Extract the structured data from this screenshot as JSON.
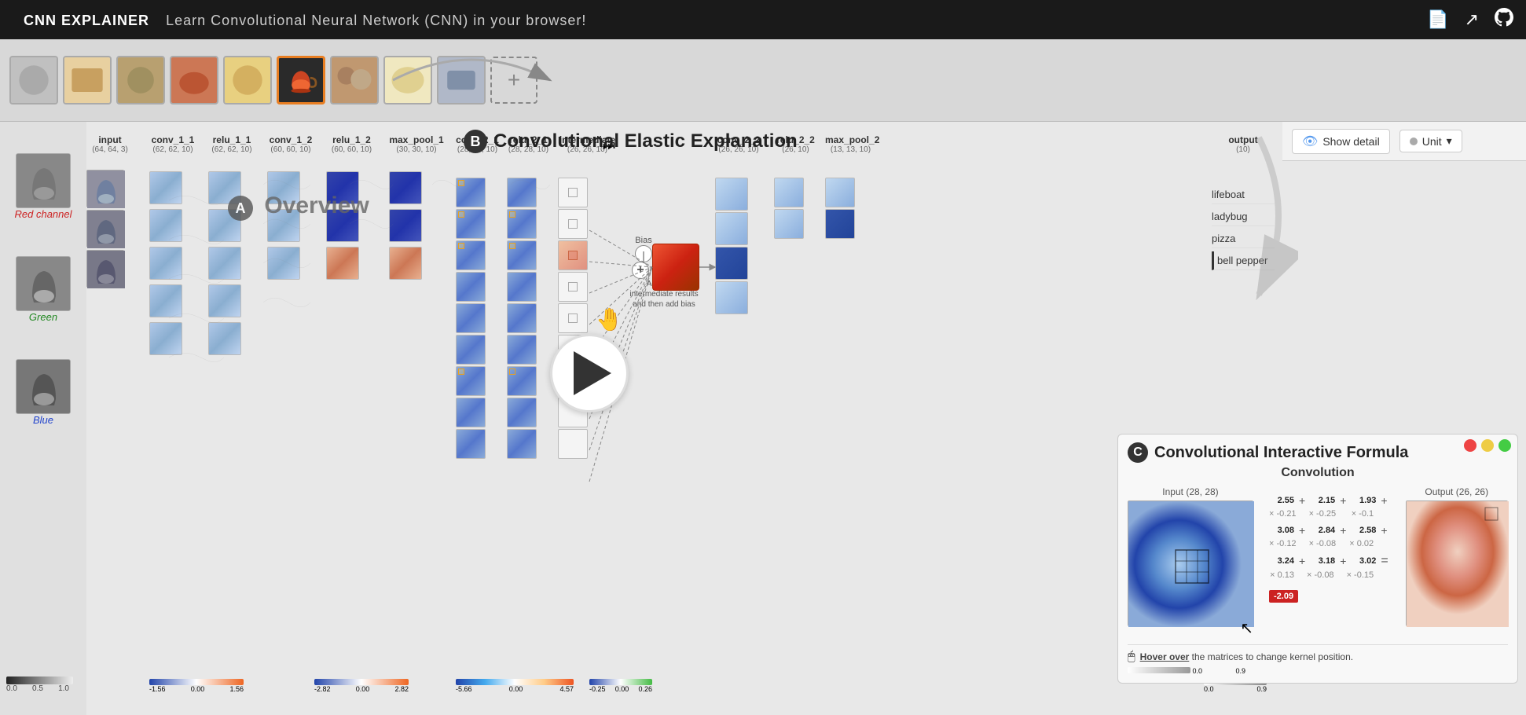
{
  "app": {
    "title": "CNN EXPLAINER",
    "subtitle": "Learn Convolutional Neural Network (CNN) in your browser!"
  },
  "toolbar": {
    "show_detail_label": "Show detail",
    "unit_label": "Unit"
  },
  "image_selector": {
    "images": [
      {
        "id": "img1",
        "color": "#c8c8c8",
        "selected": false
      },
      {
        "id": "img2",
        "color": "#d8b888",
        "selected": false
      },
      {
        "id": "img3",
        "color": "#b8a870",
        "selected": false
      },
      {
        "id": "img4",
        "color": "#cc6644",
        "selected": false
      },
      {
        "id": "img5",
        "color": "#ddcc88",
        "selected": false
      },
      {
        "id": "img6",
        "color": "#444444",
        "selected": true
      },
      {
        "id": "img7",
        "color": "#c09870",
        "selected": false
      },
      {
        "id": "img8",
        "color": "#ddcc88",
        "selected": false
      },
      {
        "id": "img9",
        "color": "#b8b8b8",
        "selected": false
      }
    ],
    "add_label": "+"
  },
  "channels": {
    "red": {
      "label": "Red channel"
    },
    "green": {
      "label": "Green"
    },
    "blue": {
      "label": "Blue"
    }
  },
  "layers": {
    "input": {
      "label": "input",
      "dims": "(64, 64, 3)"
    },
    "conv_1_1": {
      "label": "conv_1_1",
      "dims": "(62, 62, 10)"
    },
    "relu_1_1": {
      "label": "relu_1_1",
      "dims": "(62, 62, 10)"
    },
    "conv_1_2": {
      "label": "conv_1_2",
      "dims": "(60, 60, 10)"
    },
    "relu_1_2": {
      "label": "relu_1_2",
      "dims": "(60, 60, 10)"
    },
    "max_pool_1": {
      "label": "max_pool_1",
      "dims": "(30, 30, 10)"
    },
    "conv_2_1": {
      "label": "conv_2_1",
      "dims": "(28, 28, 10)"
    },
    "relu_2_1": {
      "label": "relu_2_1",
      "dims": "(28, 28, 10)"
    },
    "intermediate": {
      "label": "intermediate",
      "dims": "(26, 26, 10)"
    },
    "conv_2_2": {
      "label": "conv_2_2",
      "dims": "(26, 26, 10)"
    },
    "relu_2_2": {
      "label": "relu_2_2",
      "dims": "(26, 10)"
    },
    "max_pool_2": {
      "label": "max_pool_2",
      "dims": "(13, 13, 10)"
    },
    "output": {
      "label": "output",
      "dims": "(10)"
    }
  },
  "section_b": {
    "title": "Convolutional Elastic Explanation"
  },
  "section_c": {
    "title": "Convolutional Interactive Formula",
    "convolution_label": "Convolution",
    "input_label": "Input (28, 28)",
    "output_label": "Output (26, 26)",
    "kernel_values": [
      {
        "row": [
          {
            "val": "2.55",
            "mult": "× -0.21"
          },
          {
            "val": "2.15",
            "mult": "× -0.25"
          },
          {
            "val": "1.93",
            "mult": "× -0.1"
          }
        ]
      },
      {
        "row": [
          {
            "val": "3.08",
            "mult": "× -0.12"
          },
          {
            "val": "2.84",
            "mult": "× -0.08"
          },
          {
            "val": "2.58",
            "mult": "× 0.02"
          }
        ]
      },
      {
        "row": [
          {
            "val": "3.24",
            "mult": "× 0.13"
          },
          {
            "val": "3.18",
            "mult": "× -0.08"
          },
          {
            "val": "3.02",
            "mult": "× -0.15"
          }
        ]
      }
    ],
    "bias_value": "-2.09",
    "hover_text": "Hover over",
    "hover_suffix": "the matrices to change kernel position."
  },
  "output_labels": {
    "items": [
      "lifeboat",
      "ladybug",
      "pizza",
      "bell pepper"
    ]
  },
  "scale_bars": {
    "input": {
      "min": "0.0",
      "mid": "0.5",
      "max": "1.0"
    },
    "conv": {
      "min": "-1.56",
      "mid": "0.00",
      "max": "1.56"
    },
    "conv2": {
      "min": "-2.82",
      "mid": "0.00",
      "max": "2.82"
    },
    "elastic_left": {
      "min": "-5.66",
      "mid": "0.00",
      "max": "4.57"
    },
    "elastic_right": {
      "min": "-0.25",
      "mid": "0.00",
      "max": "0.26"
    },
    "output": {
      "min": "0.0",
      "max": "0.9"
    },
    "section_c_out": {
      "min": "0.0",
      "max": "0.9"
    }
  },
  "bias_annotation": {
    "label": "Bias",
    "add_text": "Add up all intermediate results and then add bias"
  },
  "play_button": {
    "label": "play"
  }
}
